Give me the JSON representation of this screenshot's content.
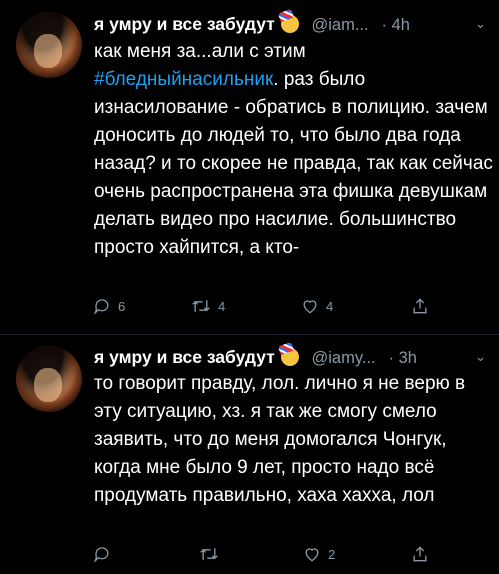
{
  "tweets": [
    {
      "name": "я умру и все забудут",
      "handle": "@iam...",
      "time": "· 4h",
      "text_before": "как меня за...али с этим ",
      "hashtag": "#бледныйнасильник",
      "text_after": ". раз было изнасилование - обратись в полицию. зачем доносить до людей то, что было два года назад? и то скорее не правда, так как сейчас очень распространена эта фишка девушкам делать видео про насилие. большинство просто хайпится, а кто-",
      "replies": "6",
      "retweets": "4",
      "likes": "4"
    },
    {
      "name": "я умру и все забудут",
      "handle": "@iamy...",
      "time": "· 3h",
      "text": "то говорит правду, лол. лично я не верю в эту ситуацию, хз. я так же смогу смело заявить, что до меня домогался Чонгук, когда мне было 9 лет, просто надо всё продумать правильно, хаха хахха, лол",
      "replies": "",
      "retweets": "",
      "likes": "2"
    }
  ],
  "icons": [
    "reply-icon",
    "retweet-icon",
    "like-icon",
    "share-icon",
    "chevron-down-icon",
    "emoji-icon"
  ]
}
